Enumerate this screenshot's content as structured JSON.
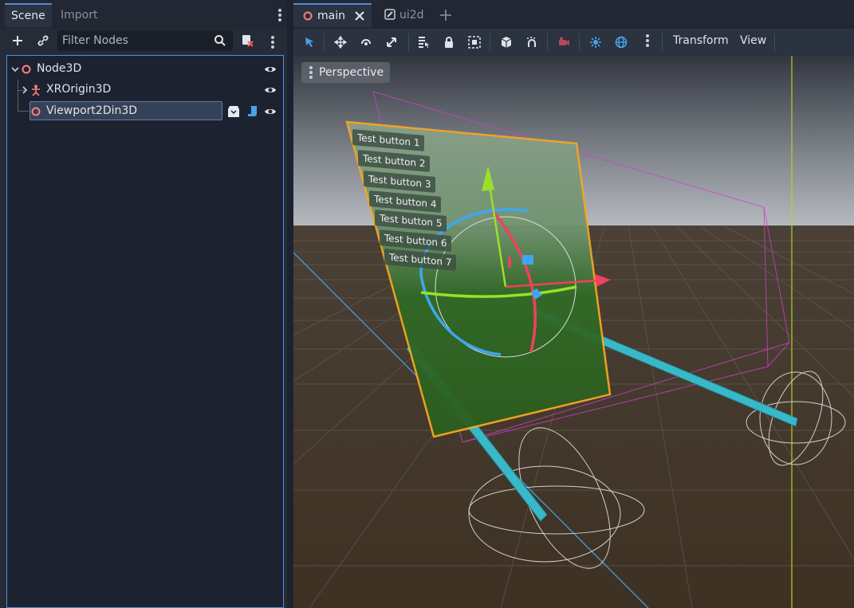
{
  "dock": {
    "tabs": [
      {
        "label": "Scene",
        "active": true
      },
      {
        "label": "Import",
        "active": false
      }
    ],
    "filter_placeholder": "Filter Nodes"
  },
  "tree": {
    "nodes": [
      {
        "label": "Node3D",
        "depth": 0,
        "icon": "node3d-icon",
        "expanded": true
      },
      {
        "label": "XROrigin3D",
        "depth": 1,
        "icon": "xrorigin-icon",
        "expanded": false
      },
      {
        "label": "Viewport2Din3D",
        "depth": 1,
        "icon": "node3d-icon",
        "selected": true
      }
    ]
  },
  "scene_tabs": [
    {
      "label": "main",
      "active": true,
      "icon": "node3d-icon"
    },
    {
      "label": "ui2d",
      "active": false,
      "icon": "scene-edit-icon"
    }
  ],
  "viewport_toolbar": {
    "transform_label": "Transform",
    "view_label": "View"
  },
  "viewport": {
    "perspective_label": "Perspective",
    "panel_buttons": [
      "Test button 1",
      "Test button 2",
      "Test button 3",
      "Test button 4",
      "Test button 5",
      "Test button 6",
      "Test button 7"
    ]
  },
  "colors": {
    "accent": "#4f8ad8",
    "node_red": "#fc7f7f",
    "panel_outline": "#f5a623",
    "gizmo_x": "#f0415e",
    "gizmo_y": "#9ae02a",
    "gizmo_z": "#3ea6f2"
  }
}
